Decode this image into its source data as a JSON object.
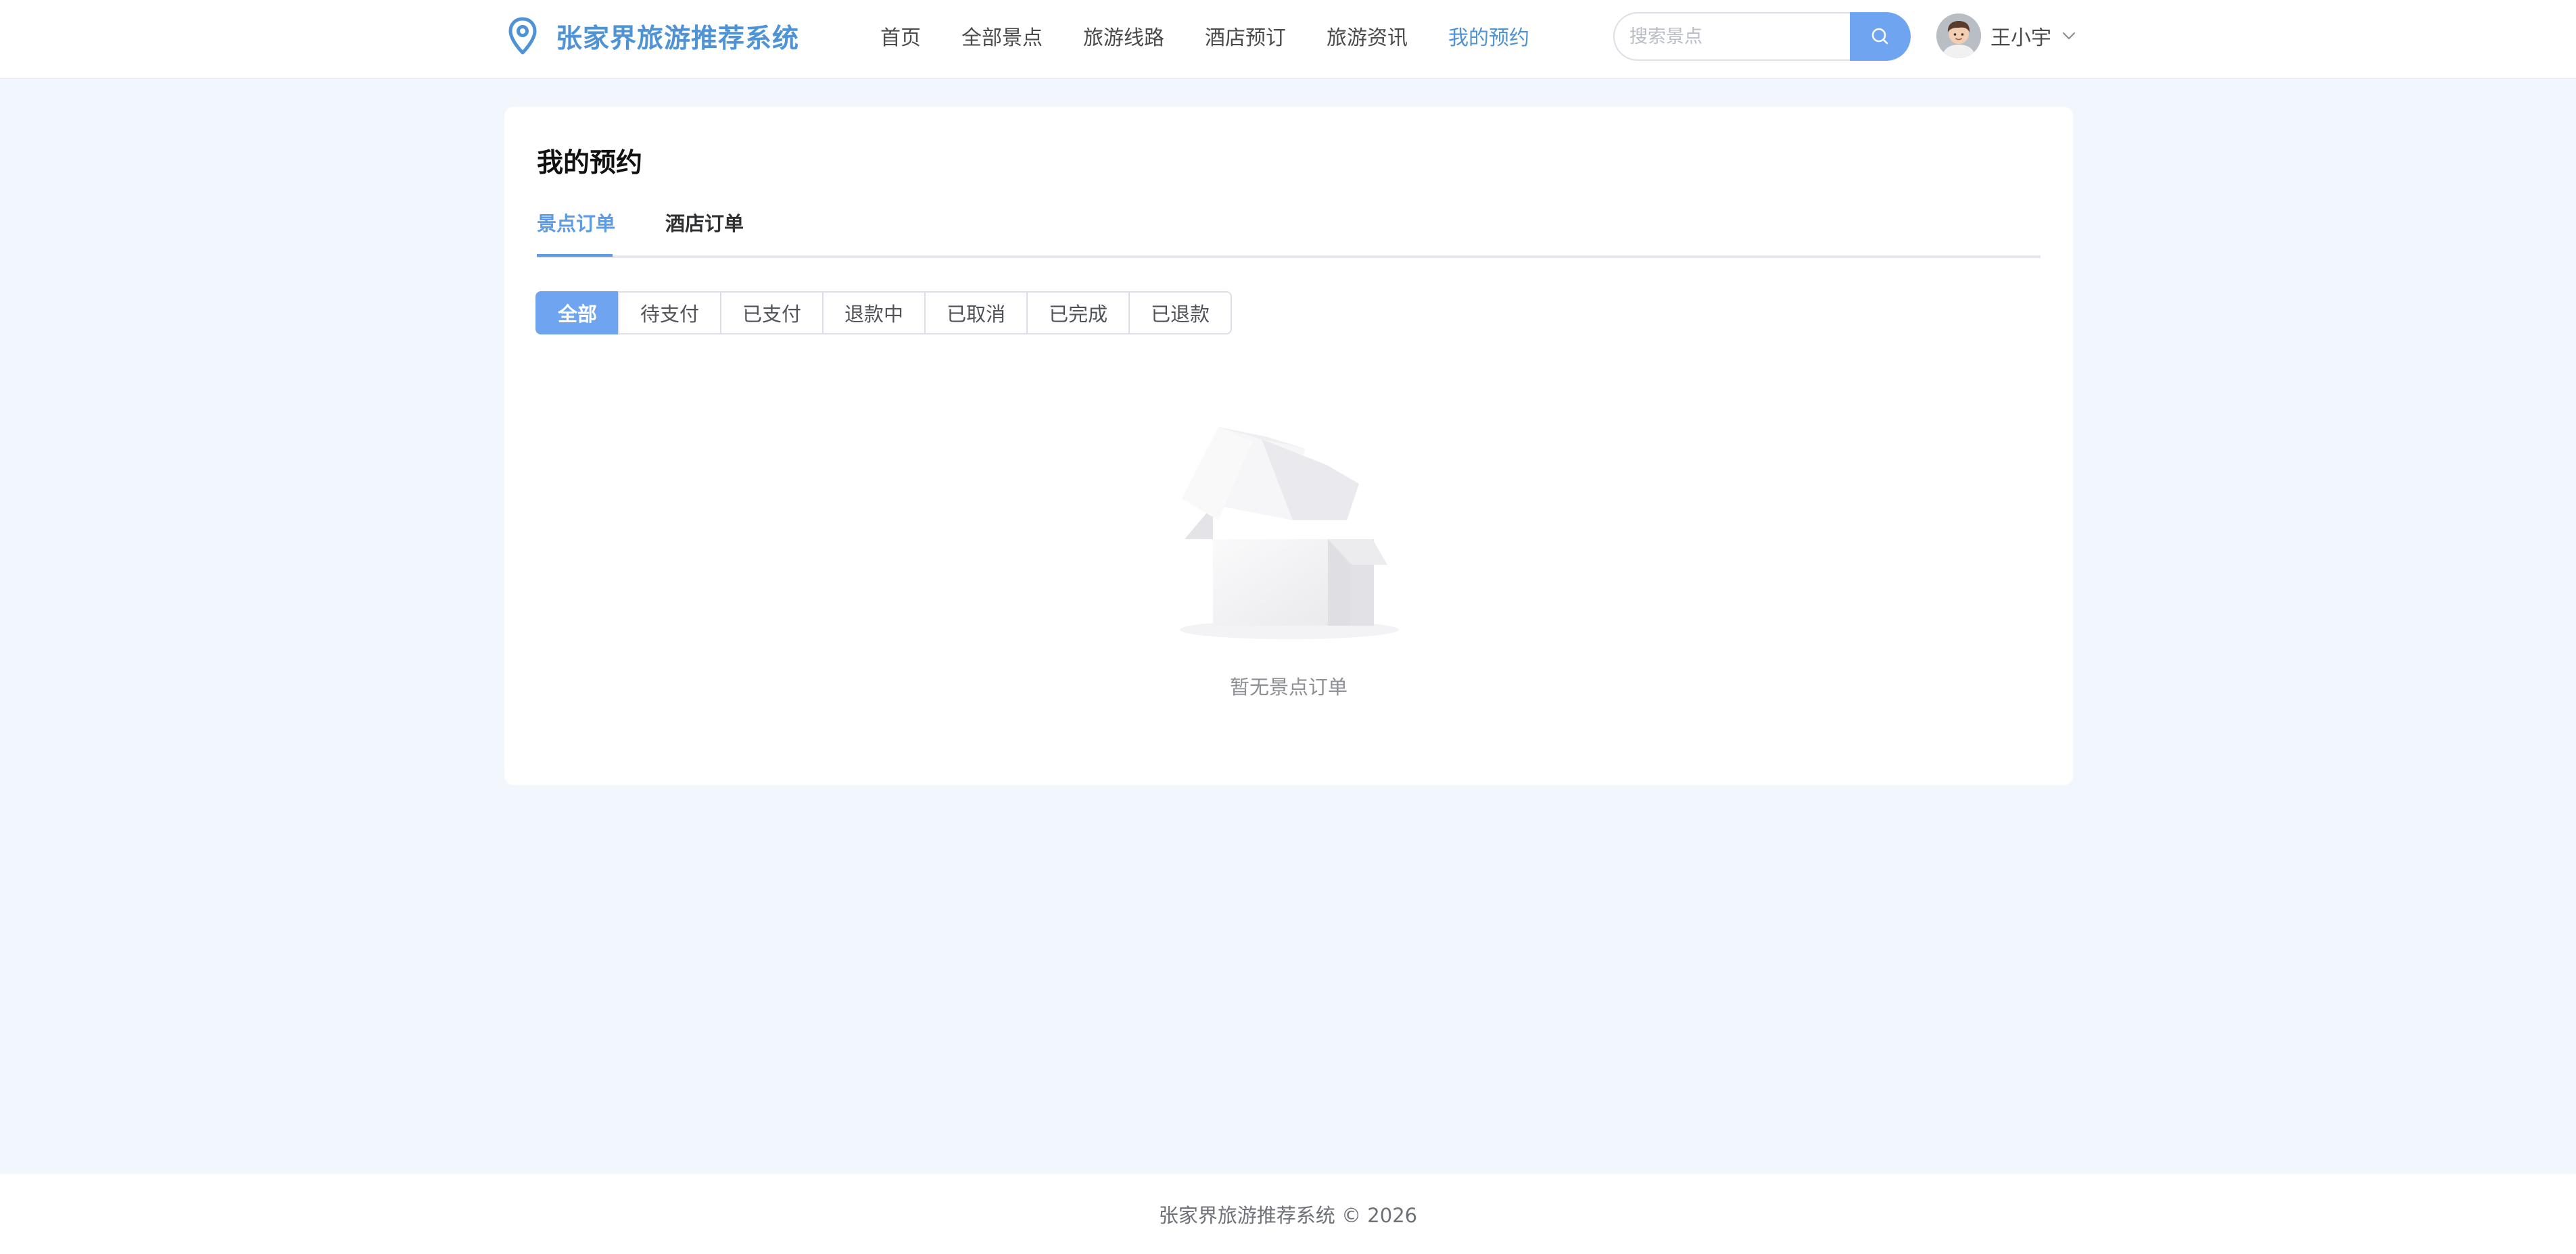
{
  "app": {
    "title": "张家界旅游推荐系统",
    "accent_color": "#4e93d6",
    "primary_color": "#6fa5f0"
  },
  "header": {
    "logo_icon": "location-pin-icon",
    "nav": [
      {
        "label": "首页"
      },
      {
        "label": "全部景点"
      },
      {
        "label": "旅游线路"
      },
      {
        "label": "酒店预订"
      },
      {
        "label": "旅游资讯"
      },
      {
        "label": "我的预约",
        "active": true
      }
    ],
    "search": {
      "placeholder": "搜索景点",
      "value": "",
      "icon": "search-icon"
    },
    "user": {
      "name": "王小宇",
      "icon": "chevron-down-icon"
    }
  },
  "main": {
    "title": "我的预约",
    "tabs": [
      {
        "label": "景点订单",
        "active": true
      },
      {
        "label": "酒店订单"
      }
    ],
    "filters": [
      {
        "label": "全部",
        "active": true
      },
      {
        "label": "待支付"
      },
      {
        "label": "已支付"
      },
      {
        "label": "退款中"
      },
      {
        "label": "已取消"
      },
      {
        "label": "已完成"
      },
      {
        "label": "已退款"
      }
    ],
    "empty": {
      "icon": "empty-box-icon",
      "text": "暂无景点订单"
    }
  },
  "footer": {
    "text": "张家界旅游推荐系统 © 2026"
  }
}
